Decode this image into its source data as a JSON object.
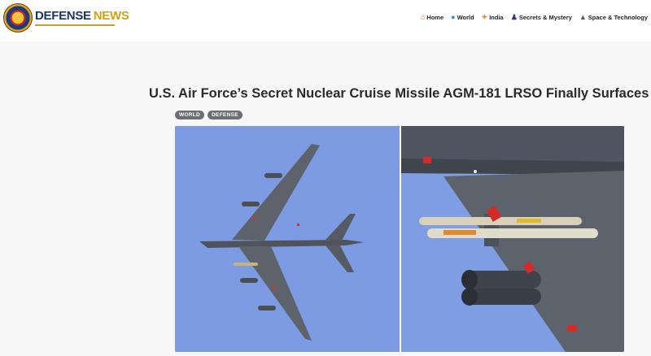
{
  "site": {
    "logo_text_1": "DEFENSE",
    "logo_text_2": "NEWS"
  },
  "nav": {
    "items": [
      {
        "label": "Home",
        "icon": "home-icon"
      },
      {
        "label": "World",
        "icon": "globe-icon"
      },
      {
        "label": "India",
        "icon": "india-map-icon"
      },
      {
        "label": "Secrets & Mystery",
        "icon": "spy-icon"
      },
      {
        "label": "Space & Technology",
        "icon": "rocket-icon"
      }
    ]
  },
  "article": {
    "title": "U.S. Air Force’s Secret Nuclear Cruise Missile AGM-181 LRSO Finally Surfaces",
    "tags": [
      "WORLD",
      "DEFENSE"
    ]
  },
  "colors": {
    "brand_navy": "#1e3463",
    "brand_gold": "#d4a017",
    "sky": "#7c9ae0",
    "tag_bg": "#6b6e73"
  }
}
